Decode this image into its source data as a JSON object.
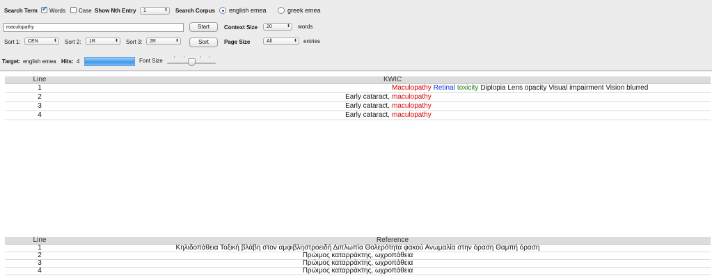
{
  "controls": {
    "search_term_label": "Search Term",
    "words_label": "Words",
    "case_label": "Case",
    "show_nth_label": "Show Nth Entry",
    "show_nth_value": "1",
    "search_corpus_label": "Search Corpus",
    "corpus_option_1": "english emea",
    "corpus_option_2": "greek emea",
    "search_input_value": "maculopathy",
    "start_label": "Start",
    "context_size_label": "Context Size",
    "context_size_value": "20",
    "words_unit": "words",
    "sort1_label": "Sort 1:",
    "sort1_value": "CEN",
    "sort2_label": "Sort 2:",
    "sort2_value": "1R",
    "sort3_label": "Sort 3:",
    "sort3_value": "2R",
    "sort_button": "Sort",
    "page_size_label": "Page Size",
    "page_size_value": "All",
    "entries_unit": "entries",
    "target_label": "Target:",
    "target_value": "english emea",
    "hits_label": "Hits:",
    "hits_value": "4",
    "font_size_label": "Font Size",
    "words_checked": true,
    "case_checked": false,
    "font_size_slider_level": 0.5
  },
  "kwic_table": {
    "headers": {
      "line": "Line",
      "kwic": "KWIC"
    },
    "rows": [
      {
        "line": "1",
        "left": "",
        "keyword": "Maculopathy",
        "right": [
          {
            "text": "Retinal",
            "color": "#1236d6"
          },
          {
            "text": "toxicity",
            "color": "#1a7a10"
          },
          {
            "text": "Diplopia Lens opacity Visual impairment Vision blurred",
            "color": "#111111"
          }
        ]
      },
      {
        "line": "2",
        "left": "Early cataract,",
        "keyword": "maculopathy",
        "right": []
      },
      {
        "line": "3",
        "left": "Early cataract,",
        "keyword": "maculopathy",
        "right": []
      },
      {
        "line": "4",
        "left": "Early cataract,",
        "keyword": "maculopathy",
        "right": []
      }
    ]
  },
  "reference_table": {
    "headers": {
      "line": "Line",
      "reference": "Reference"
    },
    "rows": [
      {
        "line": "1",
        "text": "Κηλιδοπάθεια Τοξική βλάβη στον αμφιβληστροειδή Διπλωπία Θολερότητα φακού Ανωμαλία στην όραση Θαμπή όραση"
      },
      {
        "line": "2",
        "text": "Πρώιμος καταρράκτης, ωχροπάθεια"
      },
      {
        "line": "3",
        "text": "Πρώιμος καταρράκτης, ωχροπάθεια"
      },
      {
        "line": "4",
        "text": "Πρώιμος καταρράκτης, ωχροπάθεια"
      }
    ]
  },
  "colors": {
    "keyword": "#d40000",
    "background": "#ececec",
    "hits_bar": "#4aa3ef"
  }
}
